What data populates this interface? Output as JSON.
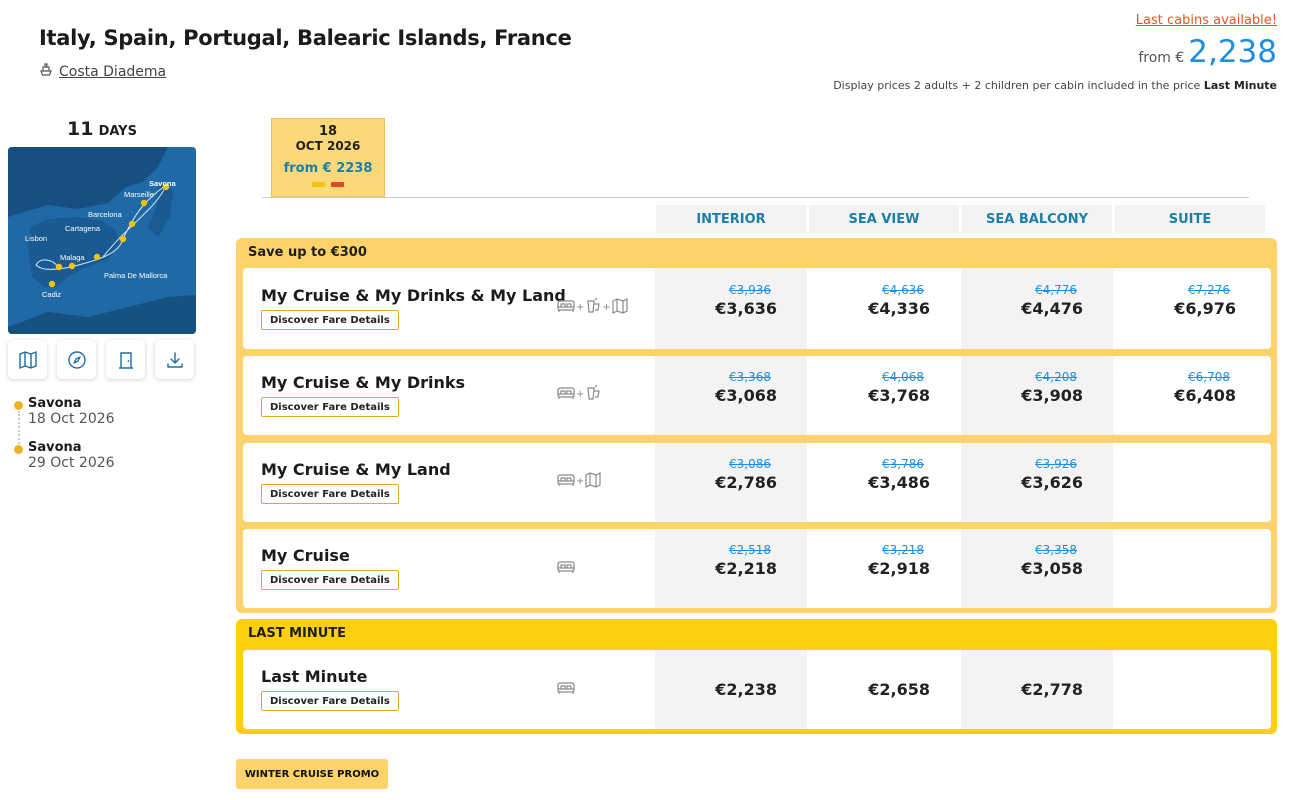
{
  "header": {
    "title": "Italy, Spain, Portugal, Balearic Islands, France",
    "ship": "Costa Diadema",
    "last_cabins": "Last cabins available!",
    "from_label": "from €",
    "from_price": "2,238",
    "display_note": "Display prices 2 adults + 2 children per cabin included in the price",
    "display_note_bold": "Last Minute"
  },
  "sidebar": {
    "days_num": "11",
    "days_label": "DAYS",
    "map_ports": [
      "Savona",
      "Marseille",
      "Barcelona",
      "Cartagena",
      "Lisbon",
      "Malaga",
      "Palma De Mallorca",
      "Cadiz"
    ],
    "tools": [
      "map-icon",
      "compass-icon",
      "door-icon",
      "download-icon"
    ],
    "itinerary": [
      {
        "port": "Savona",
        "date": "18 Oct 2026"
      },
      {
        "port": "Savona",
        "date": "29 Oct 2026"
      }
    ]
  },
  "date_tab": {
    "day": "18",
    "month": "OCT 2026",
    "price": "from € 2238",
    "indicator_colors": [
      "#f5c20a",
      "#e8442a"
    ]
  },
  "columns": [
    "INTERIOR",
    "SEA VIEW",
    "SEA BALCONY",
    "SUITE"
  ],
  "groups": [
    {
      "header": "Save up to €300",
      "fares": [
        {
          "name": "My Cruise & My Drinks & My Land",
          "button": "Discover Fare Details",
          "icons": [
            "bed-icon",
            "drink-icon",
            "map-icon"
          ],
          "prices": [
            {
              "old": "€3,936",
              "cur": "€3,636"
            },
            {
              "old": "€4,636",
              "cur": "€4,336"
            },
            {
              "old": "€4,776",
              "cur": "€4,476"
            },
            {
              "old": "€7,276",
              "cur": "€6,976"
            }
          ]
        },
        {
          "name": "My Cruise & My Drinks",
          "button": "Discover Fare Details",
          "icons": [
            "bed-icon",
            "drink-icon"
          ],
          "prices": [
            {
              "old": "€3,368",
              "cur": "€3,068"
            },
            {
              "old": "€4,068",
              "cur": "€3,768"
            },
            {
              "old": "€4,208",
              "cur": "€3,908"
            },
            {
              "old": "€6,708",
              "cur": "€6,408"
            }
          ]
        },
        {
          "name": "My Cruise & My Land",
          "button": "Discover Fare Details",
          "icons": [
            "bed-icon",
            "map-icon"
          ],
          "prices": [
            {
              "old": "€3,086",
              "cur": "€2,786"
            },
            {
              "old": "€3,786",
              "cur": "€3,486"
            },
            {
              "old": "€3,926",
              "cur": "€3,626"
            },
            {
              "old": "",
              "cur": ""
            }
          ]
        },
        {
          "name": "My Cruise",
          "button": "Discover Fare Details",
          "icons": [
            "bed-icon"
          ],
          "prices": [
            {
              "old": "€2,518",
              "cur": "€2,218"
            },
            {
              "old": "€3,218",
              "cur": "€2,918"
            },
            {
              "old": "€3,358",
              "cur": "€3,058"
            },
            {
              "old": "",
              "cur": ""
            }
          ]
        }
      ]
    },
    {
      "header": "LAST MINUTE",
      "fares": [
        {
          "name": "Last Minute",
          "button": "Discover Fare Details",
          "icons": [
            "bed-icon"
          ],
          "prices": [
            {
              "old": "",
              "cur": "€2,238"
            },
            {
              "old": "",
              "cur": "€2,658"
            },
            {
              "old": "",
              "cur": "€2,778"
            },
            {
              "old": "",
              "cur": ""
            }
          ]
        }
      ]
    }
  ],
  "promo": "WINTER CRUISE PROMO",
  "colors": {
    "accent_yellow": "#fbd36a",
    "last_minute_yellow": "#fdd00f",
    "price_blue": "#1e8fe0",
    "warning_orange": "#e2561e"
  }
}
